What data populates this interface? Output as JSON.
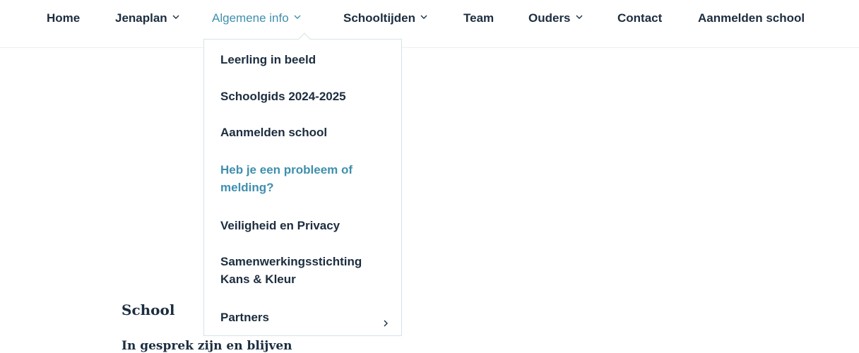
{
  "nav": {
    "items": [
      {
        "label": "Home",
        "has_submenu": false
      },
      {
        "label": "Jenaplan",
        "has_submenu": true
      },
      {
        "label": "Algemene info",
        "has_submenu": true,
        "active": true
      },
      {
        "label": "Schooltijden",
        "has_submenu": true
      },
      {
        "label": "Team",
        "has_submenu": false
      },
      {
        "label": "Ouders",
        "has_submenu": true
      },
      {
        "label": "Contact",
        "has_submenu": false
      },
      {
        "label": "Aanmelden school",
        "has_submenu": false
      }
    ],
    "active_color": "#3f8fae",
    "text_color": "#1c2d3f"
  },
  "dropdown": {
    "items": [
      {
        "label": "Leerling in beeld"
      },
      {
        "label": "Schoolgids 2024-2025"
      },
      {
        "label": "Aanmelden school"
      },
      {
        "label": "Heb je een probleem of melding?",
        "hover": true
      },
      {
        "label": "Veiligheid en Privacy"
      },
      {
        "label": "Samenwerkingsstichting Kans & Kleur"
      },
      {
        "label": "Partners",
        "has_submenu": true
      }
    ]
  },
  "content": {
    "heading": "School",
    "subheading": "In gesprek zijn en blijven"
  }
}
